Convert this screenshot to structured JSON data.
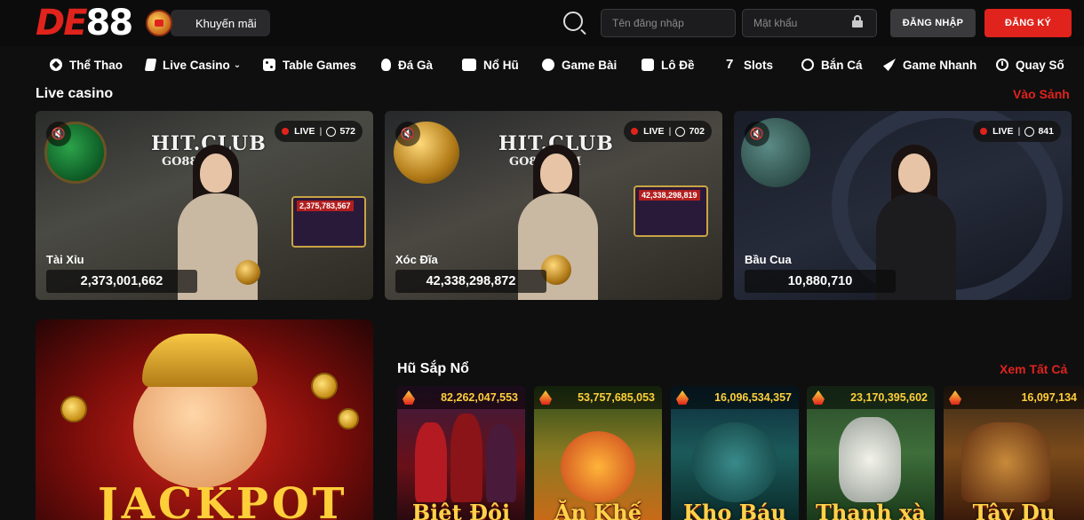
{
  "header": {
    "logo_text_a": "DE",
    "logo_text_b": "88",
    "promo_label": "Khuyến mãi",
    "username_placeholder": "Tên đăng nhập",
    "password_placeholder": "Mật khẩu",
    "login_label": "ĐĂNG NHẬP",
    "register_label": "ĐĂNG KÝ"
  },
  "nav": {
    "items": [
      {
        "label": "Thể Thao",
        "icon": "soccer-ball-icon"
      },
      {
        "label": "Live Casino",
        "icon": "cards-icon"
      },
      {
        "label": "Table Games",
        "icon": "dice-icon"
      },
      {
        "label": "Đá Gà",
        "icon": "rooster-icon"
      },
      {
        "label": "Nổ Hũ",
        "icon": "slot-machine-icon"
      },
      {
        "label": "Game Bài",
        "icon": "club-icon"
      },
      {
        "label": "Lô Đề",
        "icon": "lottery-icon"
      },
      {
        "label": "Slots",
        "icon": "seven-icon"
      },
      {
        "label": "Bắn Cá",
        "icon": "target-icon"
      },
      {
        "label": "Game Nhanh",
        "icon": "rocket-icon"
      },
      {
        "label": "Quay Số",
        "icon": "clock-icon"
      }
    ]
  },
  "live_casino": {
    "title": "Live casino",
    "link": "Vào Sảnh",
    "cards": [
      {
        "name": "Tài Xỉu",
        "jackpot": "2,373,001,662",
        "viewers": "572",
        "live": "LIVE",
        "brand": "HIT.CLUB",
        "brand_sub": "GO88.COM",
        "screen": "2,375,783,567"
      },
      {
        "name": "Xóc Đĩa",
        "jackpot": "42,338,298,872",
        "viewers": "702",
        "live": "LIVE",
        "brand": "HIT.CLUB",
        "brand_sub": "GO88.COM",
        "screen": "42,338,298,819"
      },
      {
        "name": "Bầu Cua",
        "jackpot": "10,880,710",
        "viewers": "841",
        "live": "LIVE"
      }
    ]
  },
  "jackpot_banner": {
    "text": "JACKPOT"
  },
  "hot_jackpots": {
    "title": "Hũ Sắp Nổ",
    "link": "Xem Tất Cả",
    "items": [
      {
        "amount": "82,262,047,553",
        "title": "Biệt Đội"
      },
      {
        "amount": "53,757,685,053",
        "title": "Ăn Khế"
      },
      {
        "amount": "16,096,534,357",
        "title": "Kho Báu"
      },
      {
        "amount": "23,170,395,602",
        "title": "Thanh xà"
      },
      {
        "amount": "16,097,134",
        "title": "Tây Du"
      }
    ]
  },
  "colors": {
    "accent": "#e0231c",
    "gold": "#ffcf3a",
    "background": "#0f0f10"
  }
}
